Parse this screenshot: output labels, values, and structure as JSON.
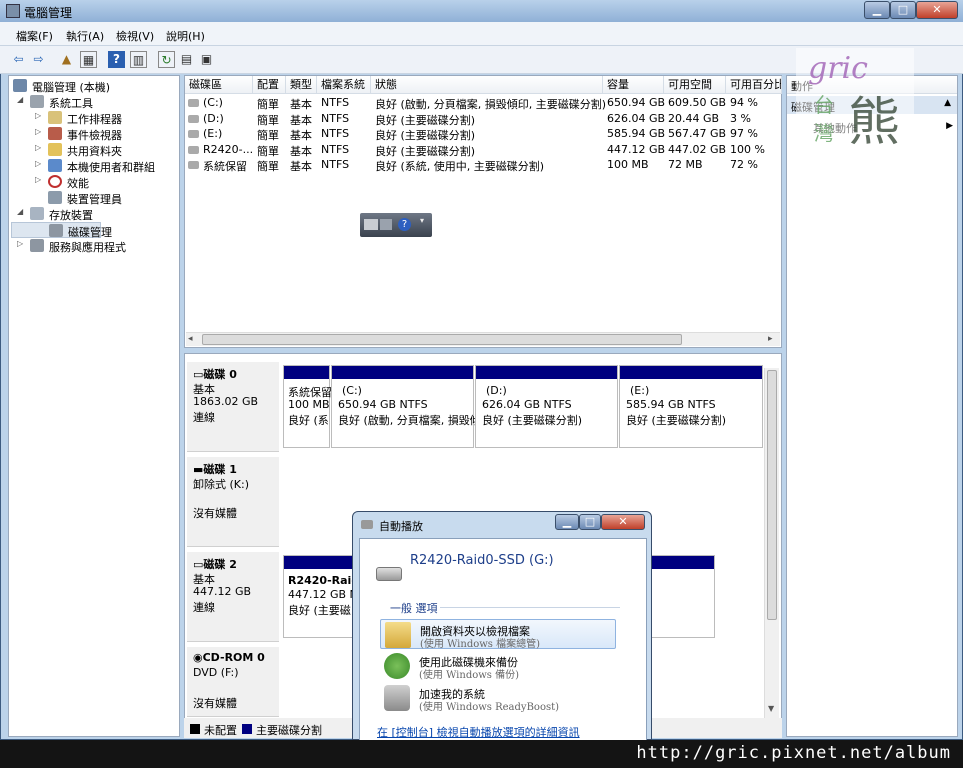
{
  "window": {
    "title": "電腦管理"
  },
  "menu": [
    "檔案(F)",
    "執行(A)",
    "檢視(V)",
    "說明(H)"
  ],
  "tree": [
    {
      "label": "電腦管理 (本機)",
      "level": 0
    },
    {
      "label": "系統工具",
      "level": 1
    },
    {
      "label": "工作排程器",
      "level": 2
    },
    {
      "label": "事件檢視器",
      "level": 2
    },
    {
      "label": "共用資料夾",
      "level": 2
    },
    {
      "label": "本機使用者和群組",
      "level": 2
    },
    {
      "label": "效能",
      "level": 2
    },
    {
      "label": "裝置管理員",
      "level": 2
    },
    {
      "label": "存放裝置",
      "level": 1
    },
    {
      "label": "磁碟管理",
      "level": 2
    },
    {
      "label": "服務與應用程式",
      "level": 1
    }
  ],
  "volume_table": {
    "headers": [
      "磁碟區",
      "配置",
      "類型",
      "檔案系統",
      "狀態",
      "容量",
      "可用空間",
      "可用百分比"
    ],
    "rows": [
      [
        "(C:)",
        "簡單",
        "基本",
        "NTFS",
        "良好 (啟動, 分頁檔案, 損毀傾印, 主要磁碟分割)",
        "650.94 GB",
        "609.50 GB",
        "94 %"
      ],
      [
        "(D:)",
        "簡單",
        "基本",
        "NTFS",
        "良好 (主要磁碟分割)",
        "626.04 GB",
        "20.44 GB",
        "3 %"
      ],
      [
        "(E:)",
        "簡單",
        "基本",
        "NTFS",
        "良好 (主要磁碟分割)",
        "585.94 GB",
        "567.47 GB",
        "97 %"
      ],
      [
        "R2420-...",
        "簡單",
        "基本",
        "NTFS",
        "良好 (主要磁碟分割)",
        "447.12 GB",
        "447.02 GB",
        "100 %"
      ],
      [
        "系統保留",
        "簡單",
        "基本",
        "NTFS",
        "良好 (系統, 使用中, 主要磁碟分割)",
        "100 MB",
        "72 MB",
        "72 %"
      ]
    ]
  },
  "disks": [
    {
      "name": "磁碟 0",
      "type": "基本",
      "size": "1863.02 GB",
      "status": "連線",
      "partitions": [
        {
          "l1": "系統保留",
          "l2": "100 MB",
          "l3": "良好 (系"
        },
        {
          "l1": "(C:)",
          "l2": "650.94 GB NTFS",
          "l3": "良好 (啟動, 分頁檔案, 損毀傾"
        },
        {
          "l1": "(D:)",
          "l2": "626.04 GB NTFS",
          "l3": "良好 (主要磁碟分割)"
        },
        {
          "l1": "(E:)",
          "l2": "585.94 GB NTFS",
          "l3": "良好 (主要磁碟分割)"
        }
      ]
    },
    {
      "name": "磁碟 1",
      "type": "卸除式 (K:)",
      "size": "",
      "status": "沒有媒體"
    },
    {
      "name": "磁碟 2",
      "type": "基本",
      "size": "447.12 GB",
      "status": "連線",
      "partitions": [
        {
          "l1": "R2420-Raid",
          "l2": "447.12 GB N",
          "l3": "良好 (主要磁"
        }
      ]
    },
    {
      "name": "CD-ROM 0",
      "type": "DVD (F:)",
      "size": "",
      "status": "沒有媒體"
    }
  ],
  "legend": [
    "未配置",
    "主要磁碟分割"
  ],
  "actions": {
    "header": "動作",
    "section": "磁碟管理",
    "more": "其他動作"
  },
  "autoplay": {
    "title": "自動播放",
    "drive": "R2420-Raid0-SSD (G:)",
    "group": "一般 選項",
    "options": [
      {
        "l1": "開啟資料夾以檢視檔案",
        "l2": "(使用 Windows 檔案總管)"
      },
      {
        "l1": "使用此磁碟機來備份",
        "l2": "(使用 Windows 備份)"
      },
      {
        "l1": "加速我的系統",
        "l2": "(使用 Windows ReadyBoost)"
      }
    ],
    "link": "在 [控制台] 檢視自動播放選項的詳細資訊"
  },
  "watermark": {
    "url": "http://gric.pixnet.net/album",
    "logo_text": "gric",
    "logo_cn": "台灣熊"
  },
  "colors": {
    "primary_partition": "#000080",
    "link": "#0645ad",
    "title_bar": "#9db9dc"
  }
}
